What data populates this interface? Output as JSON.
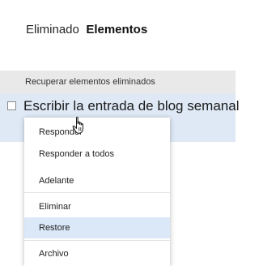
{
  "header": {
    "word_a": "Eliminado",
    "word_b": "Elementos"
  },
  "section": {
    "label": "Recuperar elementos eliminados"
  },
  "item": {
    "subject": "Escribir la entrada de blog semanal"
  },
  "menu": {
    "items": [
      {
        "label": "Responder"
      },
      {
        "label": "Responder a todos"
      },
      {
        "label": "Adelante"
      },
      {
        "label": "Eliminar"
      },
      {
        "label": "Restore"
      },
      {
        "label": "Archivo"
      }
    ],
    "highlighted": "Restore"
  },
  "colors": {
    "selection": "#dfe9f6",
    "section_bar": "#e9e9e9",
    "menu_hover": "#dbe8f8"
  },
  "icons": [
    "checkbox",
    "hand-pointer-cursor"
  ]
}
